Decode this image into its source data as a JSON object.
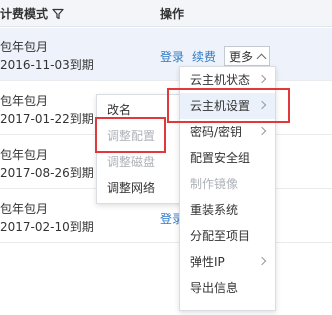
{
  "table": {
    "headers": {
      "billing_mode": "计费模式",
      "operations": "操作"
    },
    "rows": [
      {
        "billing": "包年包月",
        "expires": "2016-11-03到期"
      },
      {
        "billing": "包年包月",
        "expires": "2017-01-22到期"
      },
      {
        "billing": "包年包月",
        "expires": "2017-08-26到期"
      },
      {
        "billing": "包年包月",
        "expires": "2017-02-10到期"
      }
    ],
    "actions": {
      "login": "登录",
      "renew": "续费",
      "more": "更多"
    }
  },
  "main_menu": {
    "items": [
      {
        "label": "云主机状态",
        "submenu": true,
        "disabled": false
      },
      {
        "label": "云主机设置",
        "submenu": true,
        "disabled": false
      },
      {
        "label": "密码/密钥",
        "submenu": true,
        "disabled": false
      },
      {
        "label": "配置安全组",
        "submenu": false,
        "disabled": false
      },
      {
        "label": "制作镜像",
        "submenu": false,
        "disabled": true
      },
      {
        "label": "重装系统",
        "submenu": false,
        "disabled": false
      },
      {
        "label": "分配至项目",
        "submenu": false,
        "disabled": false
      },
      {
        "label": "弹性IP",
        "submenu": true,
        "disabled": false
      },
      {
        "label": "导出信息",
        "submenu": false,
        "disabled": false
      }
    ]
  },
  "sub_menu": {
    "items": [
      {
        "label": "改名",
        "disabled": false
      },
      {
        "label": "调整配置",
        "disabled": true
      },
      {
        "label": "调整磁盘",
        "disabled": true
      },
      {
        "label": "调整网络",
        "disabled": false
      }
    ]
  },
  "colors": {
    "link": "#2f79c5",
    "highlight": "#e0393b",
    "disabled": "#aeb2b8"
  }
}
